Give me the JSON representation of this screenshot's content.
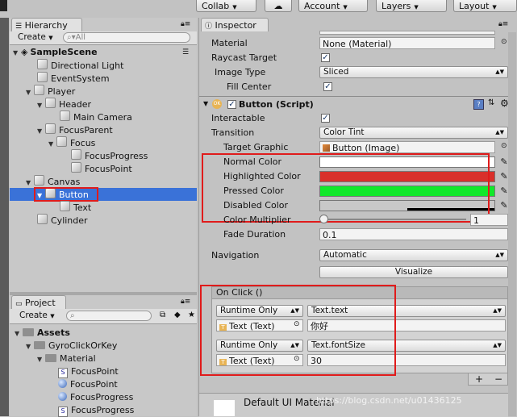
{
  "toolbar": {
    "collab": "Collab",
    "account": "Account",
    "layers": "Layers",
    "layout": "Layout",
    "cloud_icon": "cloud-icon"
  },
  "hierarchy": {
    "tab": "Hierarchy",
    "create": "Create",
    "search_placeholder": "All",
    "scene": "SampleScene",
    "items": [
      {
        "label": "Directional Light"
      },
      {
        "label": "EventSystem"
      },
      {
        "label": "Player"
      },
      {
        "label": "Header"
      },
      {
        "label": "Main Camera"
      },
      {
        "label": "FocusParent"
      },
      {
        "label": "Focus"
      },
      {
        "label": "FocusProgress"
      },
      {
        "label": "FocusPoint"
      },
      {
        "label": "Canvas"
      },
      {
        "label": "Button"
      },
      {
        "label": "Text"
      },
      {
        "label": "Cylinder"
      }
    ]
  },
  "project": {
    "tab": "Project",
    "create": "Create",
    "items": [
      {
        "label": "Assets"
      },
      {
        "label": "GyroClickOrKey"
      },
      {
        "label": "Material"
      },
      {
        "label": "FocusPoint"
      },
      {
        "label": "FocusPoint"
      },
      {
        "label": "FocusProgress"
      },
      {
        "label": "FocusProgress"
      }
    ]
  },
  "inspector": {
    "tab": "Inspector",
    "image": {
      "material_label": "Material",
      "material_value": "None (Material)",
      "raycast_label": "Raycast Target",
      "image_type_label": "Image Type",
      "image_type_value": "Sliced",
      "fill_center_label": "Fill Center"
    },
    "button": {
      "title": "Button (Script)",
      "interactable_label": "Interactable",
      "transition_label": "Transition",
      "transition_value": "Color Tint",
      "target_graphic_label": "Target Graphic",
      "target_graphic_value": "Button (Image)",
      "normal_label": "Normal Color",
      "highlighted_label": "Highlighted Color",
      "pressed_label": "Pressed Color",
      "disabled_label": "Disabled Color",
      "multiplier_label": "Color Multiplier",
      "multiplier_value": "1",
      "fade_label": "Fade Duration",
      "fade_value": "0.1",
      "navigation_label": "Navigation",
      "navigation_value": "Automatic",
      "visualize": "Visualize"
    },
    "colors": {
      "normal": "#ffffff",
      "highlighted": "#d9302b",
      "pressed": "#11e82a",
      "disabled": "#c8c8c8"
    },
    "onclick": {
      "title": "On Click ()",
      "entries": [
        {
          "mode": "Runtime Only",
          "func": "Text.text",
          "target": "Text (Text)",
          "arg": "你好"
        },
        {
          "mode": "Runtime Only",
          "func": "Text.fontSize",
          "target": "Text (Text)",
          "arg": "30"
        }
      ],
      "add": "+",
      "remove": "−"
    },
    "footer": "Default UI Material"
  },
  "watermark": "https://blog.csdn.net/u01436125"
}
